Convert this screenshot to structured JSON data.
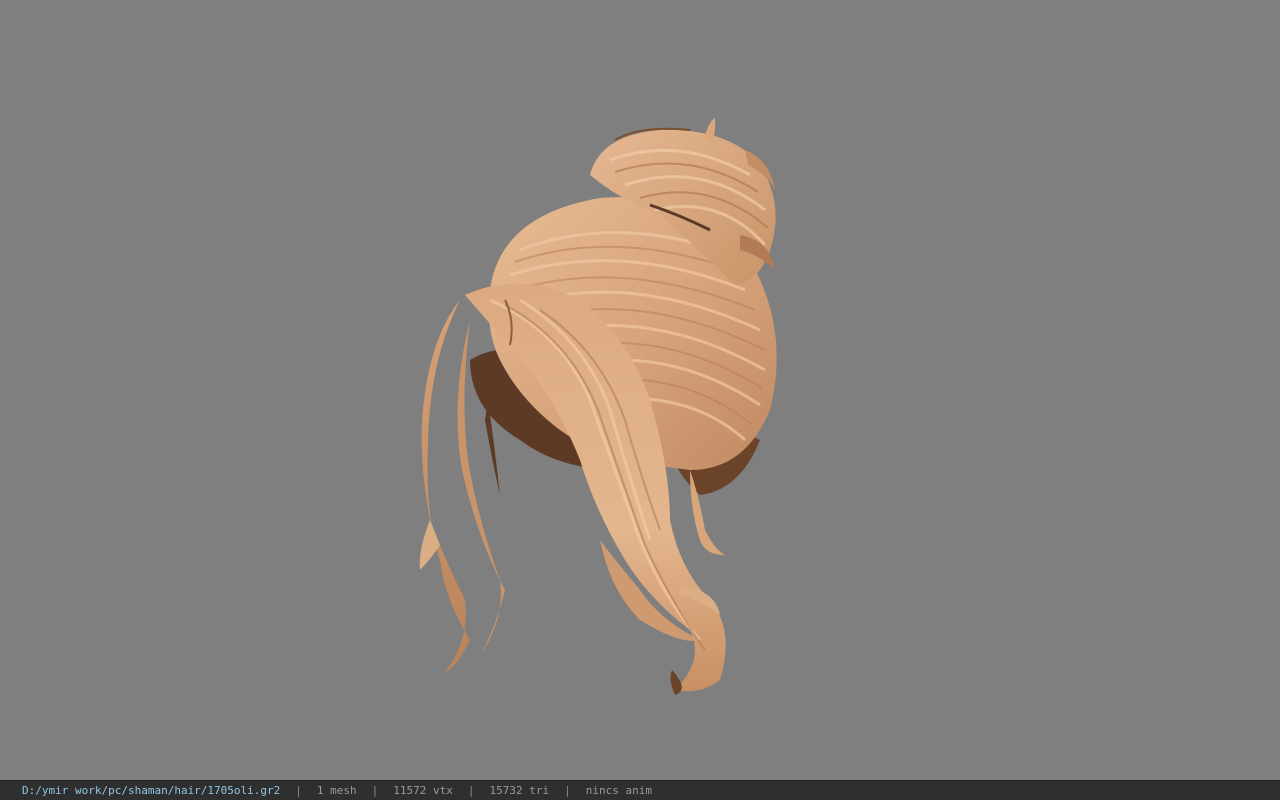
{
  "viewport": {
    "background_color": "#7f7f7f",
    "model": "hair-bun-mesh",
    "hair_colors": {
      "light": "#e2b48c",
      "mid": "#cf9a72",
      "dark": "#8e5e3e",
      "shadow": "#5d3a25"
    }
  },
  "statusbar": {
    "file_path": "D:/ymir work/pc/shaman/hair/1705oli.gr2",
    "separator": "|",
    "mesh_count": "1 mesh",
    "vertex_count": "11572 vtx",
    "triangle_count": "15732 tri",
    "anim_status": "nincs anim"
  }
}
